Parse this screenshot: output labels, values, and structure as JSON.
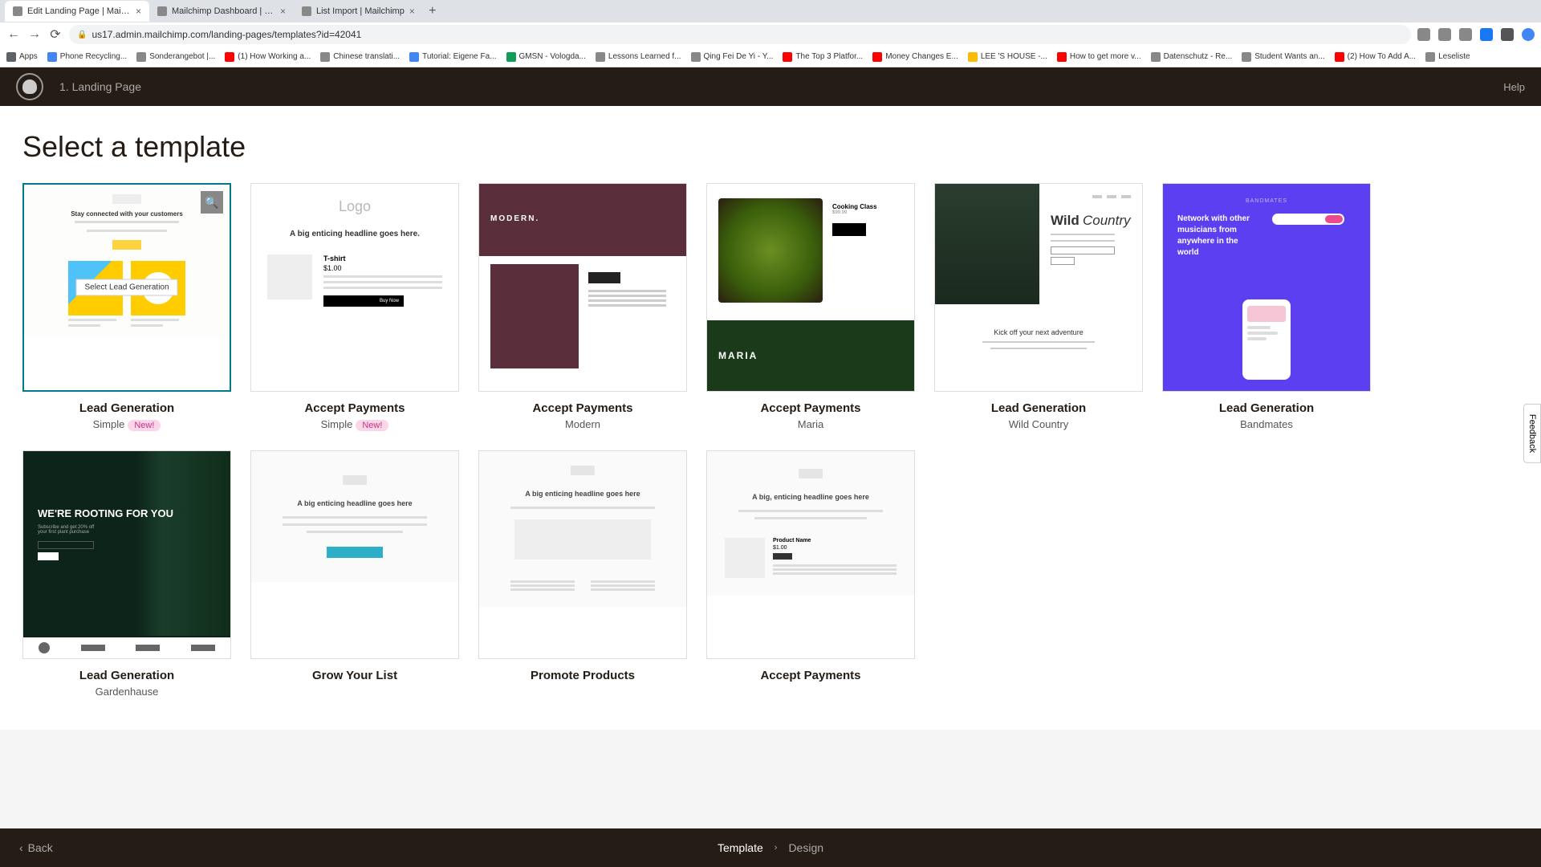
{
  "browser": {
    "tabs": [
      {
        "title": "Edit Landing Page | Mailchimp",
        "active": true
      },
      {
        "title": "Mailchimp Dashboard | Mailc...",
        "active": false
      },
      {
        "title": "List Import | Mailchimp",
        "active": false
      }
    ],
    "url": "us17.admin.mailchimp.com/landing-pages/templates?id=42041",
    "bookmarks": [
      {
        "label": "Apps",
        "color": "#5f6368"
      },
      {
        "label": "Phone Recycling...",
        "color": "#4285f4"
      },
      {
        "label": "Sonderangebot |...",
        "color": "#888"
      },
      {
        "label": "(1) How Working a...",
        "color": "#ff0000"
      },
      {
        "label": "Chinese translati...",
        "color": "#888"
      },
      {
        "label": "Tutorial: Eigene Fa...",
        "color": "#4285f4"
      },
      {
        "label": "GMSN - Vologda...",
        "color": "#0f9d58"
      },
      {
        "label": "Lessons Learned f...",
        "color": "#888"
      },
      {
        "label": "Qing Fei De Yi - Y...",
        "color": "#888"
      },
      {
        "label": "The Top 3 Platfor...",
        "color": "#ff0000"
      },
      {
        "label": "Money Changes E...",
        "color": "#ff0000"
      },
      {
        "label": "LEE 'S HOUSE -...",
        "color": "#fbbc04"
      },
      {
        "label": "How to get more v...",
        "color": "#ff0000"
      },
      {
        "label": "Datenschutz - Re...",
        "color": "#888"
      },
      {
        "label": "Student Wants an...",
        "color": "#888"
      },
      {
        "label": "(2) How To Add A...",
        "color": "#ff0000"
      },
      {
        "label": "Leseliste",
        "color": "#888"
      }
    ]
  },
  "header": {
    "breadcrumb": "1. Landing Page",
    "help": "Help"
  },
  "page": {
    "title": "Select a template",
    "feedback": "Feedback",
    "hover_label": "Select Lead Generation"
  },
  "templates": [
    {
      "title": "Lead Generation",
      "subtitle": "Simple",
      "new": true,
      "selected": true,
      "thumb": "t1",
      "t1_head": "Stay connected with your customers"
    },
    {
      "title": "Accept Payments",
      "subtitle": "Simple",
      "new": true,
      "thumb": "t2",
      "t2_logo": "Logo",
      "t2_head": "A big enticing headline goes here.",
      "t2_pname": "T-shirt",
      "t2_price": "$1.00",
      "t2_buy": "Buy Now"
    },
    {
      "title": "Accept Payments",
      "subtitle": "Modern",
      "thumb": "t3",
      "t3_brand": "MODERN."
    },
    {
      "title": "Accept Payments",
      "subtitle": "Maria",
      "thumb": "t4",
      "t4_title": "Cooking Class",
      "t4_sub": "$99.99",
      "t4_name": "MARIA"
    },
    {
      "title": "Lead Generation",
      "subtitle": "Wild Country",
      "thumb": "t5",
      "t5_wc1": "Wild",
      "t5_wc2": "Country",
      "t5_kick": "Kick off your next adventure"
    },
    {
      "title": "Lead Generation",
      "subtitle": "Bandmates",
      "thumb": "t6",
      "t6_logo": "BANDMATES",
      "t6_txt": "Network with other musicians from anywhere in the world"
    },
    {
      "title": "Lead Generation",
      "subtitle": "Gardenhause",
      "thumb": "t7",
      "t7_head": "WE'RE ROOTING FOR YOU"
    },
    {
      "title": "Grow Your List",
      "subtitle": "",
      "thumb": "t8",
      "tg_head": "A big enticing headline goes here"
    },
    {
      "title": "Promote Products",
      "subtitle": "",
      "thumb": "t9",
      "tg_head": "A big enticing headline goes here"
    },
    {
      "title": "Accept Payments",
      "subtitle": "",
      "thumb": "t10",
      "tg_head": "A big, enticing headline goes here",
      "tg_pname": "Product Name",
      "tg_pprice": "$1.00"
    }
  ],
  "footer": {
    "back": "Back",
    "step1": "Template",
    "step2": "Design"
  },
  "new_badge": "New!"
}
